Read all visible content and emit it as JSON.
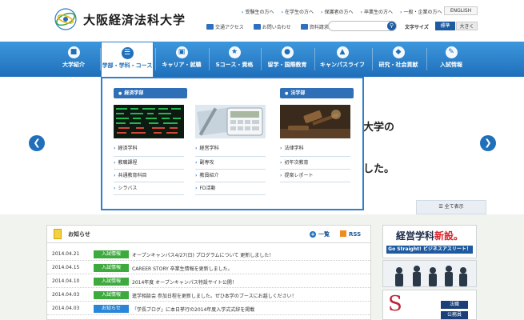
{
  "header": {
    "logo_text": "大阪経済法科大学",
    "top_links": [
      "受験生の方へ",
      "在学生の方へ",
      "保護者の方へ",
      "卒業生の方へ",
      "一般・企業の方へ"
    ],
    "english_label": "ENGLISH",
    "util_links": [
      "交通アクセス",
      "お問い合わせ",
      "資料請求"
    ],
    "search_placeholder": "",
    "font_size_label": "文字サイズ",
    "font_size_standard": "標準",
    "font_size_large": "大きく"
  },
  "gnav": {
    "items": [
      {
        "label": "大学紹介",
        "icon": "building-icon"
      },
      {
        "label": "学部・学科・コース",
        "icon": "book-icon"
      },
      {
        "label": "キャリア・就職",
        "icon": "briefcase-icon"
      },
      {
        "label": "Sコース・資格",
        "icon": "certificate-icon"
      },
      {
        "label": "留学・国際教育",
        "icon": "globe-icon"
      },
      {
        "label": "キャンパスライフ",
        "icon": "campus-icon"
      },
      {
        "label": "研究・社会貢献",
        "icon": "research-icon"
      },
      {
        "label": "入試情報",
        "icon": "pencil-icon"
      }
    ]
  },
  "megamenu": {
    "col1": {
      "heading": "経済学部",
      "dept": "経済学科",
      "links": [
        "教職課程",
        "共通教育科目",
        "シラバス"
      ]
    },
    "col2": {
      "heading": "",
      "dept": "経営学科",
      "links": [
        "副専攻",
        "教員紹介",
        "FD活動"
      ]
    },
    "col3": {
      "heading": "法学部",
      "dept": "法律学科",
      "links": [
        "初年次教育",
        "提案レポート"
      ]
    }
  },
  "hero": {
    "text1": "大学の",
    "text2": "した。",
    "view_all": "全て表示"
  },
  "news": {
    "title": "お知らせ",
    "list_label": "一覧",
    "rss_label": "RSS",
    "items": [
      {
        "date": "2014.04.21",
        "tag": "入試情報",
        "tag_color": "#3daa3d",
        "text": "オープンキャンパス4/27(日) プログラムについて 更新しました！"
      },
      {
        "date": "2014.04.15",
        "tag": "入試情報",
        "tag_color": "#3daa3d",
        "text": "CAREER STORY 卒業生情報を更新しました。"
      },
      {
        "date": "2014.04.10",
        "tag": "入試情報",
        "tag_color": "#3daa3d",
        "text": "2014年度 オープンキャンパス特設サイト公開！"
      },
      {
        "date": "2014.04.03",
        "tag": "入試情報",
        "tag_color": "#3daa3d",
        "text": "進学相談会 参加日程を更新しました。ぜひ本学のブースにお越しください！"
      },
      {
        "date": "2014.04.03",
        "tag": "お知らせ",
        "tag_color": "#2a86d6",
        "text": "「学長ブログ」に本日挙行の2014年度入学式式辞を掲載"
      }
    ]
  },
  "banners": {
    "b1_title_a": "経営学科",
    "b1_title_b": "新設。",
    "b1_sub": "Go Straight! ビジネスアスリート！",
    "b3_letter": "S",
    "b3_tag1": "法職",
    "b3_tag2": "公務員"
  },
  "colors": {
    "nav_blue": "#1f6fba",
    "accent_green": "#3daa3d",
    "accent_blue": "#2a86d6"
  }
}
